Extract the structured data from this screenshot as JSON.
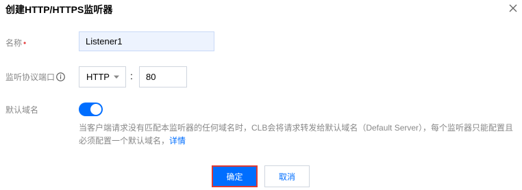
{
  "dialog": {
    "title": "创建HTTP/HTTPS监听器",
    "close_icon": "close-icon"
  },
  "form": {
    "name": {
      "label": "名称",
      "required_mark": "•",
      "value": "Listener1"
    },
    "protocol_port": {
      "label": "监听协议端口",
      "info_icon": "info-circle-icon",
      "protocol_value": "HTTP",
      "separator": ":",
      "port_value": "80"
    },
    "default_domain": {
      "label": "默认域名",
      "enabled": true,
      "help_text": "当客户端请求没有匹配本监听器的任何域名时，CLB会将请求转发给默认域名（Default Server），每个监听器只能配置且必须配置一个默认域名，",
      "help_link": "详情"
    }
  },
  "footer": {
    "confirm_label": "确定",
    "cancel_label": "取消"
  },
  "colors": {
    "primary": "#006eff",
    "highlight_border": "#e03a32",
    "required": "#e54545"
  }
}
